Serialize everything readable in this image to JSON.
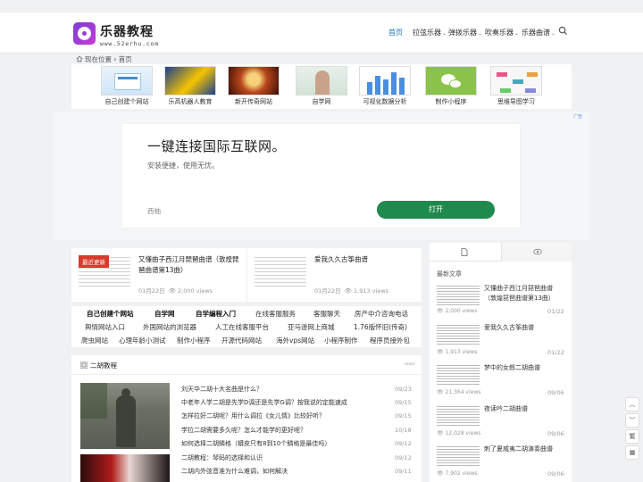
{
  "header": {
    "site_title": "乐器教程",
    "site_url": "www.52erhu.com",
    "nav": [
      {
        "label": "首页",
        "active": true
      },
      {
        "label": "拉弦乐器",
        "has_dropdown": true
      },
      {
        "label": "弹拨乐器",
        "has_dropdown": true
      },
      {
        "label": "吹奏乐器",
        "has_dropdown": true
      },
      {
        "label": "乐器曲谱",
        "has_dropdown": true
      }
    ],
    "search_icon": "search-icon"
  },
  "breadcrumb": {
    "prefix": "现在位置",
    "sep": "›",
    "current": "首页"
  },
  "apps": [
    {
      "label": "自己创建个网站"
    },
    {
      "label": "乐高机器人教育"
    },
    {
      "label": "新开传奇网站"
    },
    {
      "label": "自学网"
    },
    {
      "label": "可视化数据分析"
    },
    {
      "label": "制作小程序"
    },
    {
      "label": "思维导图学习"
    }
  ],
  "ad": {
    "mark": "广告",
    "title": "一键连接国际互联网。",
    "subtitle": "安装便捷，使用无忧。",
    "brand": "西柚",
    "button": "打开"
  },
  "featured": [
    {
      "badge": "最近更新",
      "title": "又懂曲子西江月琵琶曲谱（敦煌琵琶曲谱第13曲）",
      "date": "01月22日",
      "views": "2,000 views"
    },
    {
      "title": "爱我久久古筝曲谱",
      "date": "01月22日",
      "views": "1,913 views"
    }
  ],
  "tags": [
    [
      "自己创建个网站",
      "自学网",
      "自学编程入门",
      "在线客服服务",
      "客服聊天",
      "房产中介咨询电话"
    ],
    [
      "舆情网站入口",
      "外国网站的浏览器",
      "人工在线客服平台",
      "亚马逊网上商城",
      "1.76版怀旧(传奇)"
    ],
    [
      "爬虫网站",
      "心理年龄小测试",
      "制作小程序",
      "开源代码网站",
      "海外vps网站",
      "小程序制作",
      "程序员接外包"
    ]
  ],
  "section": {
    "title": "二胡教程",
    "more": "more",
    "articles": [
      {
        "title": "刘天华二胡十大名曲是什么？",
        "date": "09/23"
      },
      {
        "title": "中老年人学二胡是先学D调还是先学G调？按我说的定能速成",
        "date": "09/15"
      },
      {
        "title": "怎样拉好二胡呢？用什么调拉《女儿情》比较好听？",
        "date": "09/15"
      },
      {
        "title": "学拉二胡需要多久呢？怎么才能学的更好呢？",
        "date": "10/18"
      },
      {
        "title": "如何选择二胡鳞格（蟒皮只有8到10个鳞格是最佳吗）",
        "date": "09/12"
      },
      {
        "title": "二胡教程：琴码的选择和认识",
        "date": "09/12"
      },
      {
        "title": "二胡内外弦音准为什么难调，如何解决",
        "date": "09/11"
      }
    ]
  },
  "sidebar": {
    "section_label": "最新文章",
    "items": [
      {
        "title": "又懂曲子西江月琵琶曲谱（敦煌琵琶曲谱第13曲）",
        "views": "2,000 views",
        "date": "01/22"
      },
      {
        "title": "爱我久久古筝曲谱",
        "views": "1,913 views",
        "date": "01/22"
      },
      {
        "title": "梦中的女郎二胡曲谱",
        "views": "21,364 views",
        "date": "09/06"
      },
      {
        "title": "夜读吟二胡曲谱",
        "views": "12,028 views",
        "date": "09/06"
      },
      {
        "title": "刺了夏威夷二胡演奏曲谱",
        "views": "7,902 views",
        "date": "09/06"
      }
    ]
  },
  "floating": {
    "traditional": "繁"
  },
  "colors": {
    "accent": "#1e73be",
    "badge": "#d83a2b",
    "ad_button": "#1f8a4d"
  }
}
